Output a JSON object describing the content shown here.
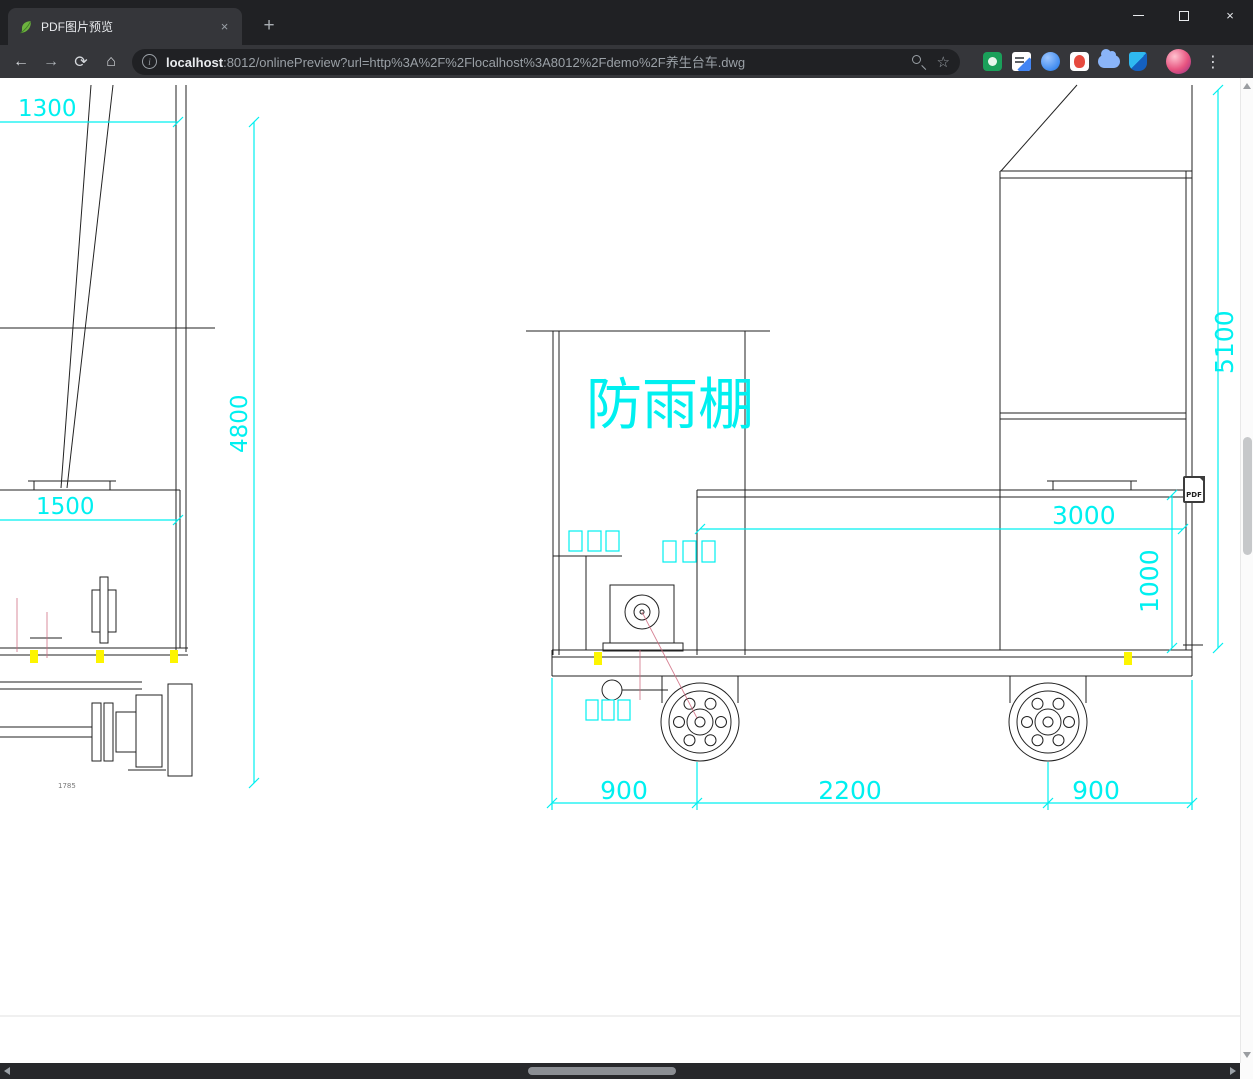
{
  "browser": {
    "tab": {
      "title": "PDF图片预览",
      "close_icon": "×"
    },
    "new_tab_icon": "+",
    "window_controls": {
      "close": "×"
    },
    "nav": {
      "back": "←",
      "forward": "→",
      "reload": "⟳",
      "home": "⌂"
    },
    "address": {
      "info_icon": "i",
      "host": "localhost",
      "path": ":8012/onlinePreview?url=http%3A%2F%2Flocalhost%3A8012%2Fdemo%2F养生台车.dwg",
      "star_icon": "☆"
    },
    "menu_icon": "⋮"
  },
  "page": {
    "pdf_badge": "PDF",
    "drawing": {
      "canopy_label": "防雨棚",
      "dim_1300": "1300",
      "dim_4800": "4800",
      "dim_1500": "1500",
      "dim_5100": "5100",
      "dim_3000": "3000",
      "dim_1000": "1000",
      "dim_900_left": "900",
      "dim_2200": "2200",
      "dim_900_right": "900",
      "dim_small": "1785"
    },
    "colors": {
      "dimension_cyan": "#00f0f0",
      "line_black": "#222222",
      "highlight_yellow": "#fdf500",
      "leader_red": "#cf6b80"
    }
  }
}
